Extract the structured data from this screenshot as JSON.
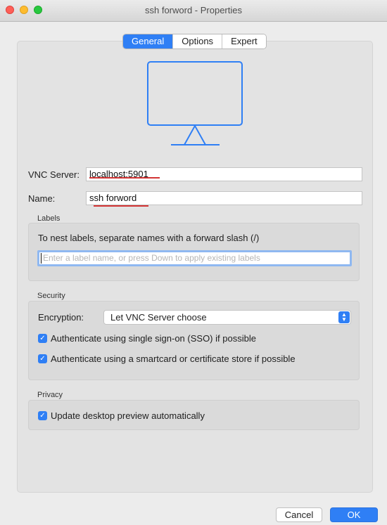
{
  "window": {
    "title": "ssh forword - Properties"
  },
  "tabs": [
    {
      "label": "General",
      "active": true
    },
    {
      "label": "Options",
      "active": false
    },
    {
      "label": "Expert",
      "active": false
    }
  ],
  "fields": {
    "vnc_server_label": "VNC Server:",
    "vnc_server_value": "localhost:5901",
    "name_label": "Name:",
    "name_value": "ssh forword"
  },
  "labels_section": {
    "title": "Labels",
    "help": "To nest labels, separate names with a forward slash (/)",
    "placeholder": "Enter a label name, or press Down to apply existing labels"
  },
  "security_section": {
    "title": "Security",
    "encryption_label": "Encryption:",
    "encryption_value": "Let VNC Server choose",
    "sso_label": "Authenticate using single sign-on (SSO) if possible",
    "smartcard_label": "Authenticate using a smartcard or certificate store if possible"
  },
  "privacy_section": {
    "title": "Privacy",
    "preview_label": "Update desktop preview automatically"
  },
  "buttons": {
    "cancel": "Cancel",
    "ok": "OK"
  },
  "colors": {
    "accent": "#2f7ff5",
    "spellcheck": "#d23434"
  },
  "icons": {
    "preview": "monitor-icon",
    "select": "updown-arrows-icon",
    "check": "checkmark-icon"
  }
}
